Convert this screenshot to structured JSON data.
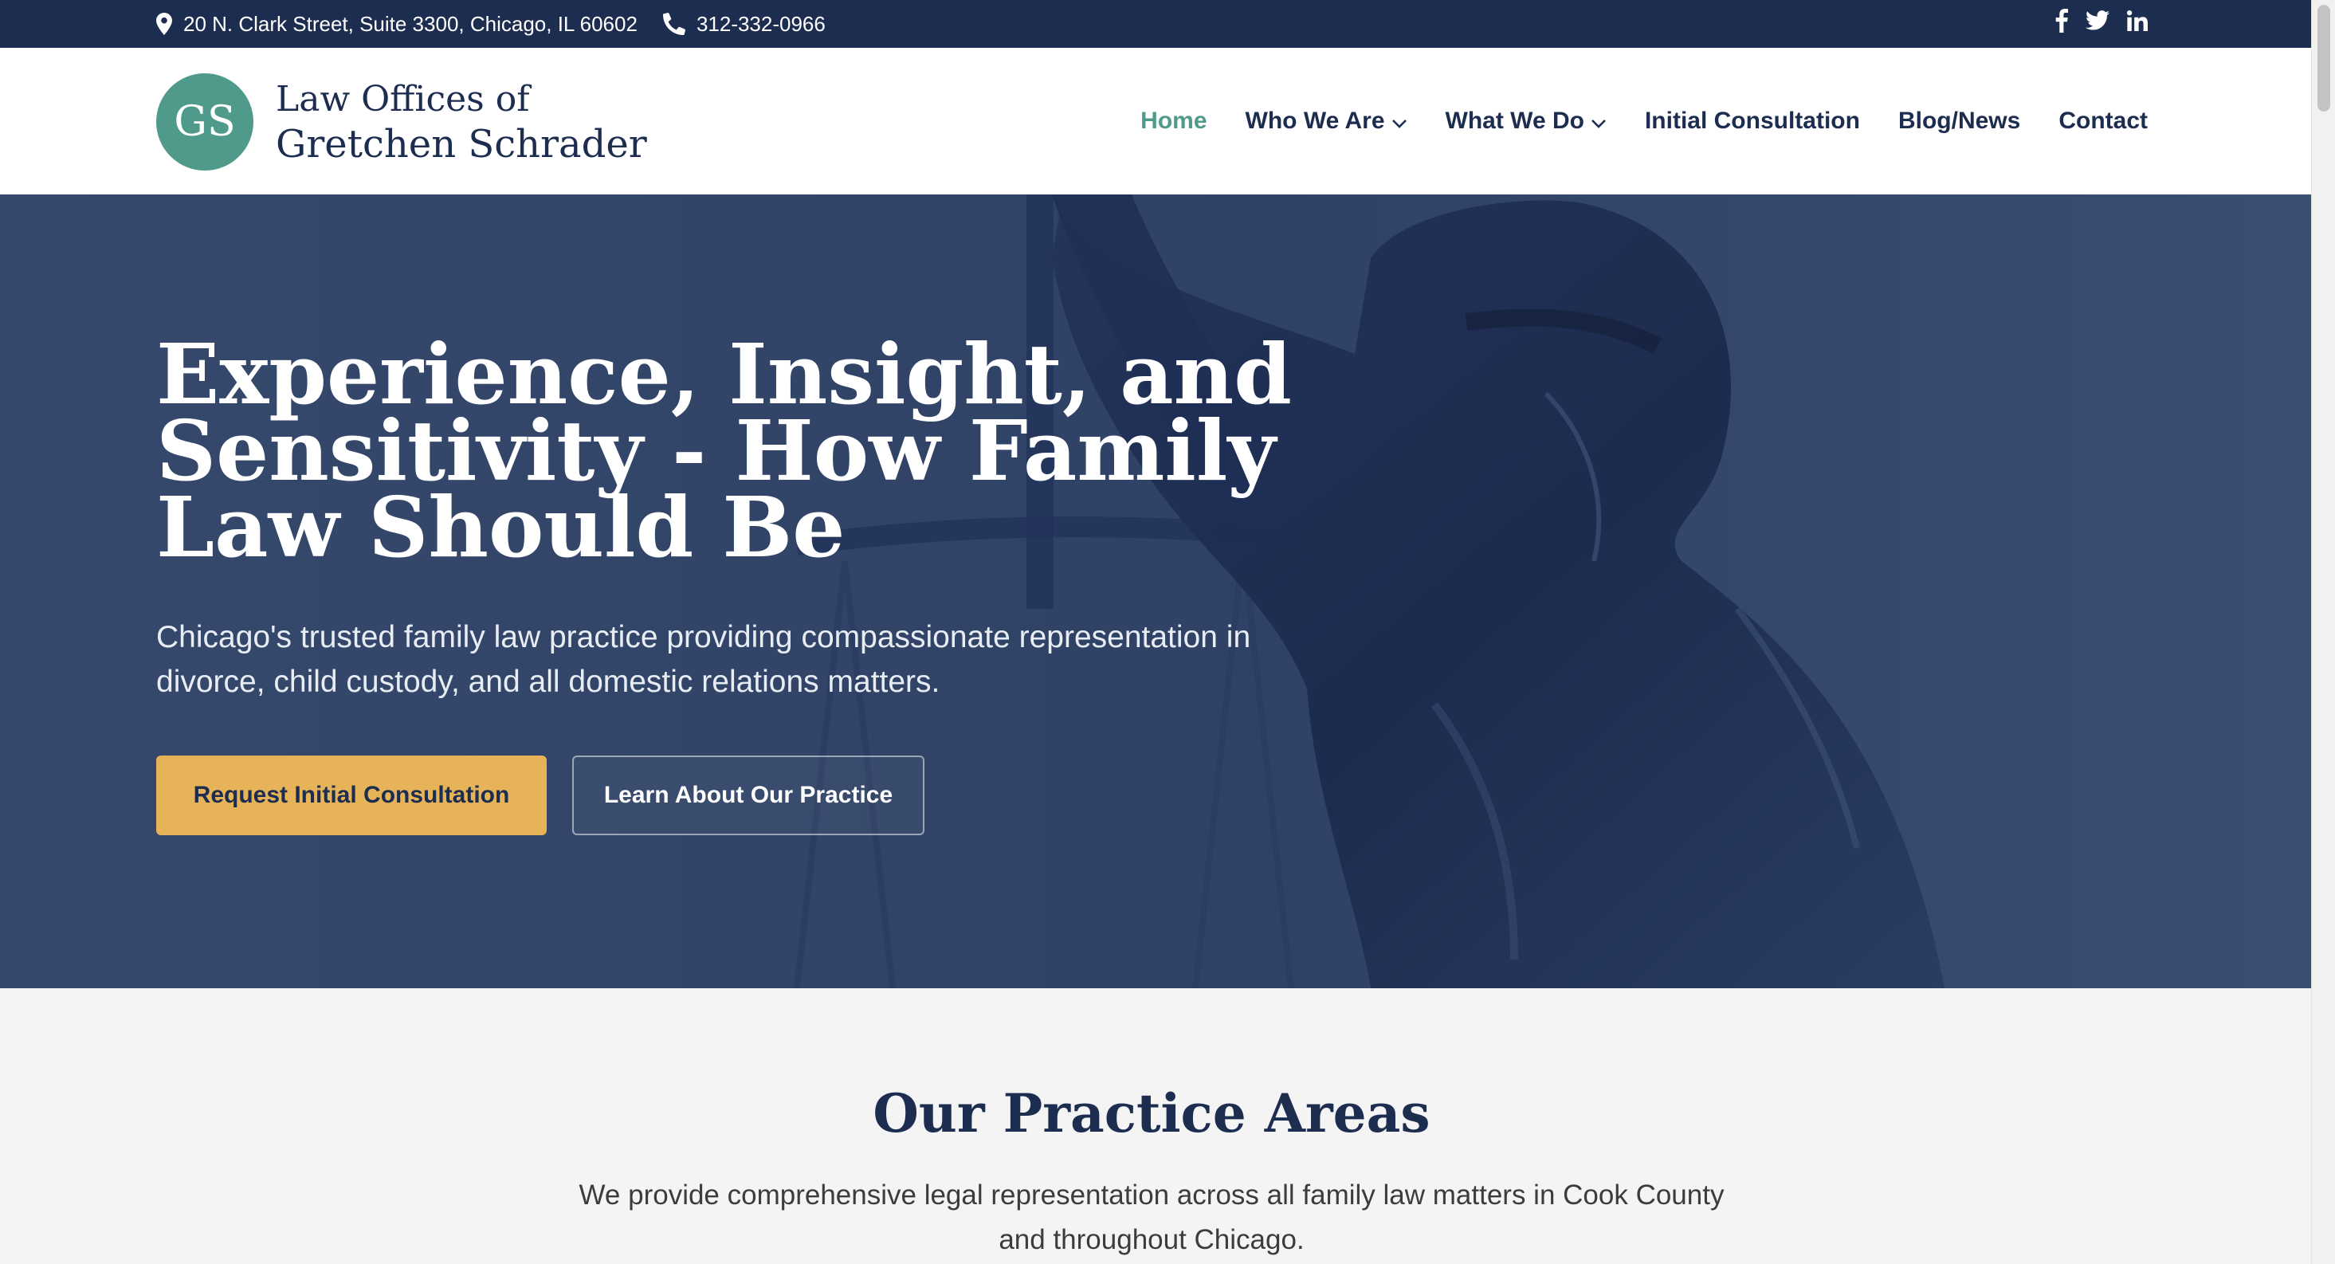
{
  "topbar": {
    "address": "20 N. Clark Street, Suite 3300, Chicago, IL 60602",
    "phone": "312-332-0966",
    "social": [
      "facebook-icon",
      "twitter-icon",
      "linkedin-icon"
    ]
  },
  "logo": {
    "initials": "GS",
    "line1": "Law Offices of",
    "line2": "Gretchen Schrader"
  },
  "nav": {
    "items": [
      {
        "label": "Home",
        "active": true
      },
      {
        "label": "Who We Are",
        "dropdown": true
      },
      {
        "label": "What We Do",
        "dropdown": true
      },
      {
        "label": "Initial Consultation"
      },
      {
        "label": "Blog/News"
      },
      {
        "label": "Contact"
      }
    ]
  },
  "hero": {
    "title": "Experience, Insight, and Sensitivity - How Family Law Should Be",
    "subtitle": "Chicago's trusted family law practice providing compassionate representation in divorce, child custody, and all domestic relations matters.",
    "primary_button": "Request Initial Consultation",
    "secondary_button": "Learn About Our Practice"
  },
  "practice": {
    "title": "Our Practice Areas",
    "description": "We provide comprehensive legal representation across all family law matters in Cook County and throughout Chicago."
  },
  "colors": {
    "navy": "#1c2d50",
    "teal": "#4f9a8a",
    "gold": "#e6b359",
    "hero_overlay": "#34496e"
  }
}
